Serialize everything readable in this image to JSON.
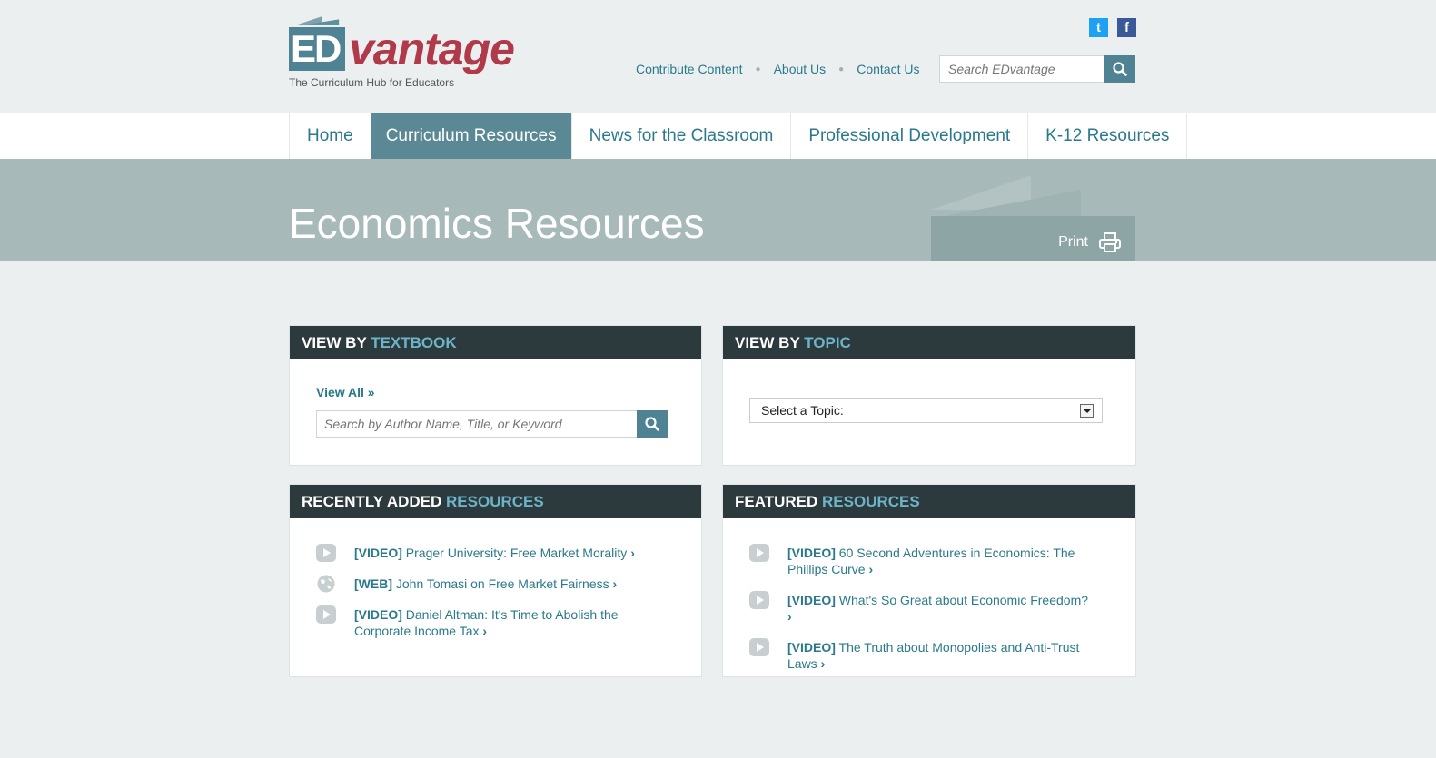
{
  "brand": {
    "logo_ed": "ED",
    "logo_vantage": "vantage",
    "tagline": "The Curriculum Hub for Educators"
  },
  "social": {
    "twitter": "t",
    "facebook": "f"
  },
  "toplinks": [
    "Contribute Content",
    "About Us",
    "Contact Us"
  ],
  "search_top": {
    "placeholder": "Search EDvantage"
  },
  "nav": [
    {
      "label": "Home",
      "active": false
    },
    {
      "label": "Curriculum Resources",
      "active": true
    },
    {
      "label": "News for the Classroom",
      "active": false
    },
    {
      "label": "Professional Development",
      "active": false
    },
    {
      "label": "K-12 Resources",
      "active": false
    }
  ],
  "page_title": "Economics Resources",
  "print_label": "Print",
  "panels": {
    "textbook": {
      "head_a": "View by ",
      "head_b": "Textbook",
      "view_all": "View All »",
      "search_placeholder": "Search by Author Name, Title, or Keyword"
    },
    "topic": {
      "head_a": "View by ",
      "head_b": "Topic",
      "select_value": "Select a Topic:"
    },
    "recent": {
      "head_a": "Recently Added ",
      "head_b": "Resources",
      "items": [
        {
          "icon": "play-icon",
          "type": "[VIDEO]",
          "title": "Prager University: Free Market Morality"
        },
        {
          "icon": "globe-icon",
          "type": "[WEB]",
          "title": "John Tomasi on Free Market Fairness"
        },
        {
          "icon": "play-icon",
          "type": "[VIDEO]",
          "title": "Daniel Altman: It's Time to Abolish the Corporate Income Tax"
        }
      ]
    },
    "featured": {
      "head_a": "Featured ",
      "head_b": "Resources",
      "items": [
        {
          "icon": "play-icon",
          "type": "[VIDEO]",
          "title": "60 Second Adventures in Economics: The Phillips Curve"
        },
        {
          "icon": "play-icon",
          "type": "[VIDEO]",
          "title": "What's So Great about Economic Freedom?"
        },
        {
          "icon": "play-icon",
          "type": "[VIDEO]",
          "title": "The Truth about Monopolies and Anti-Trust Laws"
        }
      ]
    }
  },
  "colors": {
    "teal": "#4f8394",
    "brand_red": "#b03a4a",
    "banner": "#a8b9b9",
    "panel_head": "#2d3a3d",
    "accent": "#6cb4c8"
  }
}
